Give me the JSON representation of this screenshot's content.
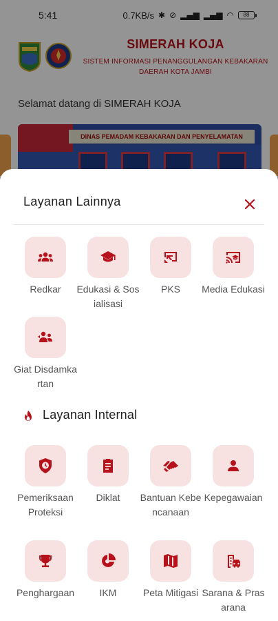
{
  "status_bar": {
    "time": "5:41",
    "network_speed": "0.7KB/s",
    "battery": "88"
  },
  "app": {
    "title": "SIMERAH KOJA",
    "subtitle_line1": "SISTEM INFORMASI PENANGGULANGAN KEBAKARAN",
    "subtitle_line2": "DAERAH KOTA JAMBI",
    "welcome": "Selamat datang di SIMERAH KOJA",
    "banner_sign": "DINAS PEMADAM KEBAKARAN DAN PENYELAMATAN"
  },
  "sheet": {
    "title": "Layanan Lainnya",
    "items": [
      {
        "label": "Redkar",
        "icon": "group-icon"
      },
      {
        "label": "Edukasi & Sosialisasi",
        "icon": "graduation-cap-icon"
      },
      {
        "label": "PKS",
        "icon": "handshake-doc-icon"
      },
      {
        "label": "Media Edukasi",
        "icon": "cast-education-icon"
      },
      {
        "label": "Giat Disdamkartan",
        "icon": "team-activity-icon"
      }
    ]
  },
  "internal": {
    "title": "Layanan Internal",
    "items": [
      {
        "label": "Pemeriksaan Proteksi",
        "icon": "shield-clock-icon"
      },
      {
        "label": "Diklat",
        "icon": "clipboard-icon"
      },
      {
        "label": "Bantuan Kebencanaan",
        "icon": "helping-hand-icon"
      },
      {
        "label": "Kepegawaian",
        "icon": "person-icon"
      },
      {
        "label": "Penghargaan",
        "icon": "trophy-icon"
      },
      {
        "label": "IKM",
        "icon": "pie-chart-icon"
      },
      {
        "label": "Peta Mitigasi",
        "icon": "map-icon"
      },
      {
        "label": "Sarana & Prasarana",
        "icon": "building-car-icon"
      }
    ]
  },
  "colors": {
    "accent": "#b5121b",
    "tile_bg": "#f8e1e1"
  }
}
